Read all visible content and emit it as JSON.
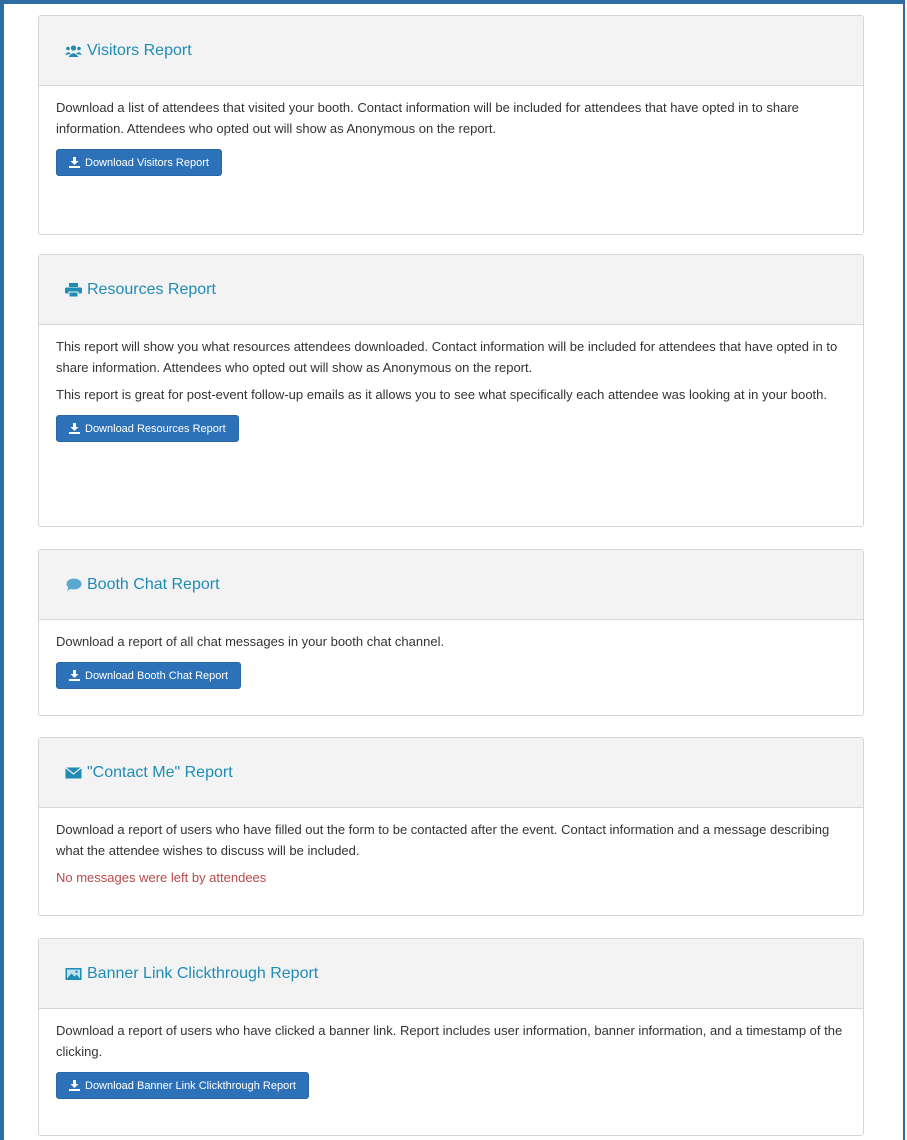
{
  "colors": {
    "accent": "#1f8cb6",
    "button": "#2d72b8",
    "warning": "#b94a48",
    "frame": "#2e6da4"
  },
  "panels": [
    {
      "icon": "users-icon",
      "title": "Visitors Report",
      "paragraphs": [
        "Download a list of attendees that visited your booth. Contact information will be included for attendees that have opted in to share information. Attendees who opted out will show as Anonymous on the report."
      ],
      "button": "Download Visitors Report"
    },
    {
      "icon": "print-icon",
      "title": "Resources Report",
      "paragraphs": [
        "This report will show you what resources attendees downloaded. Contact information will be included for attendees that have opted in to share information. Attendees who opted out will show as Anonymous on the report.",
        "This report is great for post-event follow-up emails as it allows you to see what specifically each attendee was looking at in your booth."
      ],
      "button": "Download Resources Report"
    },
    {
      "icon": "chat-bubble-icon",
      "title": "Booth Chat Report",
      "paragraphs": [
        "Download a report of all chat messages in your booth chat channel."
      ],
      "button": "Download Booth Chat Report"
    },
    {
      "icon": "envelope-icon",
      "title": "\"Contact Me\" Report",
      "paragraphs": [
        "Download a report of users who have filled out the form to be contacted after the event. Contact information and a message describing what the attendee wishes to discuss will be included."
      ],
      "notice": "No messages were left by attendees"
    },
    {
      "icon": "image-icon",
      "title": "Banner Link Clickthrough Report",
      "paragraphs": [
        "Download a report of users who have clicked a banner link. Report includes user information, banner information, and a timestamp of the clicking."
      ],
      "button": "Download Banner Link Clickthrough Report"
    }
  ]
}
